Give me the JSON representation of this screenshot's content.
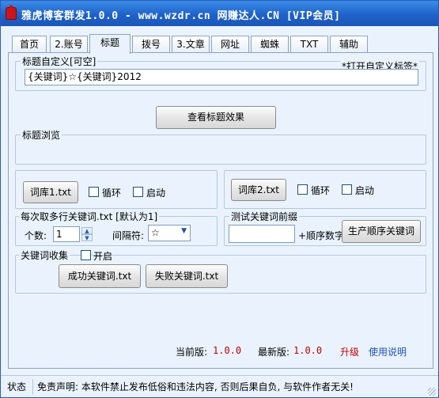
{
  "window": {
    "title": "雅虎博客群发1.0.0 - www.wzdr.cn 网赚达人.CN [VIP会员]"
  },
  "tabs": [
    {
      "label": "首页"
    },
    {
      "label": "2.账号"
    },
    {
      "label": "标题"
    },
    {
      "label": "拨号"
    },
    {
      "label": "3.文章"
    },
    {
      "label": "网址"
    },
    {
      "label": "蜘蛛"
    },
    {
      "label": "TXT"
    },
    {
      "label": "辅助"
    }
  ],
  "title_section": {
    "legend": "标题自定义[可空]",
    "custom_tag_link": "*打开自定义标签*",
    "title_value": "{关键词}☆{关键词}2012",
    "preview_button": "查看标题效果"
  },
  "preview_section": {
    "legend": "标题浏览"
  },
  "lib1": {
    "button": "词库1.txt",
    "loop_label": "循环",
    "start_label": "启动"
  },
  "lib2": {
    "button": "词库2.txt",
    "loop_label": "循环",
    "start_label": "启动"
  },
  "multi_section": {
    "legend": "每次取多行关键词.txt [默认为1]",
    "count_label": "个数:",
    "count_value": "1",
    "separator_label": "间隔符:",
    "separator_value": "☆"
  },
  "test_section": {
    "legend": "测试关键词前缀",
    "suffix_label": "+顺序数字",
    "generate_button": "生产顺序关键词"
  },
  "collect_section": {
    "legend": "关键词收集",
    "enable_label": "开启",
    "success_button": "成功关键词.txt",
    "fail_button": "失败关键词.txt"
  },
  "version": {
    "current_label": "当前版:",
    "current_value": "1.0.0",
    "latest_label": "最新版:",
    "latest_value": "1.0.0",
    "upgrade_link": "升级",
    "help_link": "使用说明"
  },
  "statusbar": {
    "status_label": "状态",
    "disclaimer": "免责声明: 本软件禁止发布低俗和违法内容, 否则后果自负, 与软件作者无关!"
  },
  "colors": {
    "titlebar": "#1f62c9",
    "window_bg": "#eaf3fd",
    "version_red": "#c00000",
    "link_blue": "#1f4fbf"
  }
}
